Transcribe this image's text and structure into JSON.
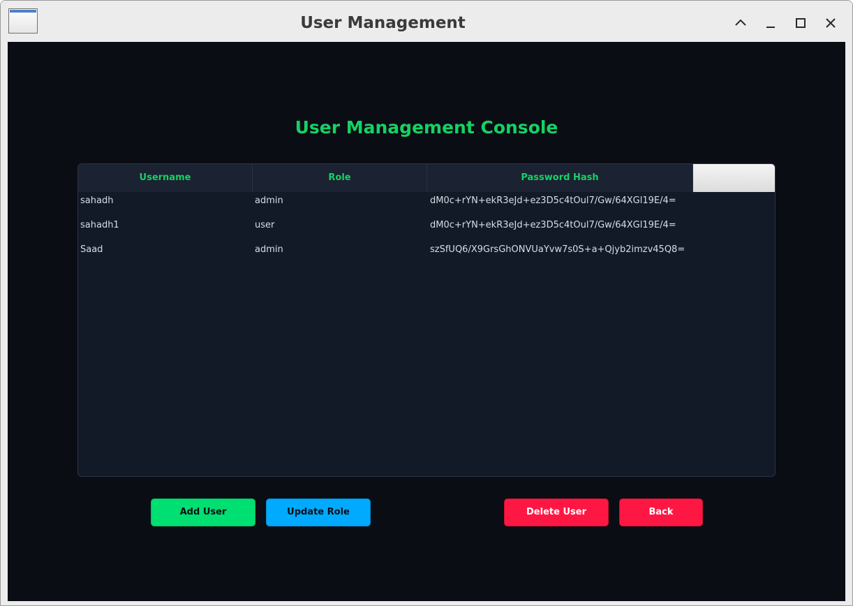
{
  "window": {
    "title": "User Management",
    "controls": [
      "chevron-up-icon",
      "minimize-icon",
      "maximize-icon",
      "close-icon"
    ]
  },
  "console": {
    "title": "User Management Console"
  },
  "table": {
    "columns": [
      "Username",
      "Role",
      "Password Hash"
    ],
    "rows": [
      {
        "username": "sahadh",
        "role": "admin",
        "hash": "dM0c+rYN+ekR3eJd+ez3D5c4tOul7/Gw/64XGl19E/4="
      },
      {
        "username": "sahadh1",
        "role": "user",
        "hash": "dM0c+rYN+ekR3eJd+ez3D5c4tOul7/Gw/64XGl19E/4="
      },
      {
        "username": "Saad",
        "role": "admin",
        "hash": "szSfUQ6/X9GrsGhONVUaYvw7s0S+a+Qjyb2imzv45Q8="
      }
    ]
  },
  "actions": {
    "add_user": "Add User",
    "update_role": "Update Role",
    "delete_user": "Delete User",
    "back": "Back"
  },
  "colors": {
    "accent_green": "#14d264",
    "add_button": "#00df72",
    "update_button": "#00aaff",
    "danger_button": "#ff1744",
    "background": "#0a0d14"
  }
}
